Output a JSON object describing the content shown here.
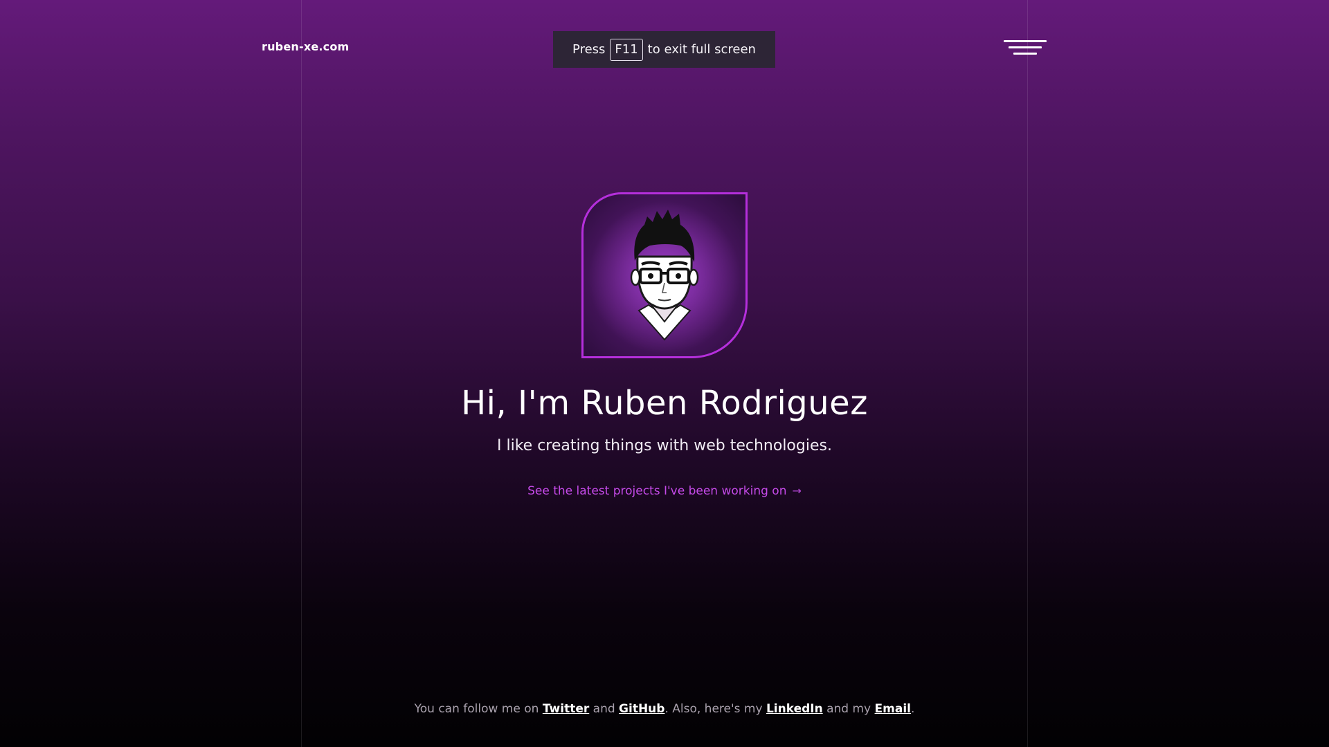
{
  "site": {
    "brand": "ruben-xe.com"
  },
  "fullscreen_notice": {
    "prefix": "Press",
    "key": "F11",
    "suffix": "to exit full screen"
  },
  "hero": {
    "headline": "Hi, I'm Ruben Rodriguez",
    "tagline": "I like creating things with web technologies.",
    "cta_label": "See the latest projects I've been working on",
    "cta_arrow": "→"
  },
  "footer": {
    "text_1": "You can follow me on",
    "twitter": "Twitter",
    "text_2": "and",
    "github": "GitHub",
    "text_3": ". Also, here's my",
    "linkedin": "LinkedIn",
    "text_4": "and my",
    "email": "Email",
    "text_5": "."
  },
  "colors": {
    "accent": "#c54ae8",
    "frame_border": "#b52fdc",
    "notice_bg": "#2d2536"
  },
  "icons": {
    "menu": "hamburger-menu-icon",
    "avatar": "cartoon-avatar-illustration",
    "arrow": "arrow-right-icon"
  }
}
